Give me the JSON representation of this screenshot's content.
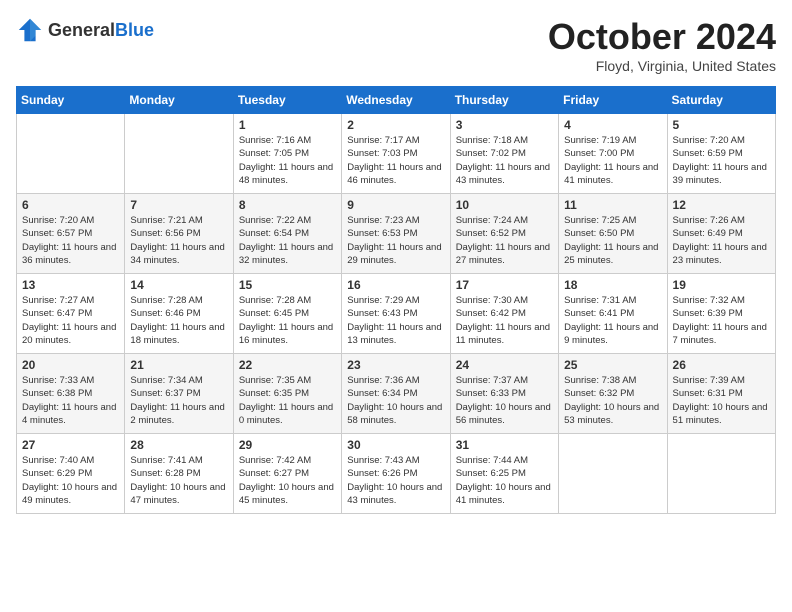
{
  "logo": {
    "general": "General",
    "blue": "Blue"
  },
  "header": {
    "month": "October 2024",
    "location": "Floyd, Virginia, United States"
  },
  "days_of_week": [
    "Sunday",
    "Monday",
    "Tuesday",
    "Wednesday",
    "Thursday",
    "Friday",
    "Saturday"
  ],
  "weeks": [
    [
      {
        "day": "",
        "sunrise": "",
        "sunset": "",
        "daylight": ""
      },
      {
        "day": "",
        "sunrise": "",
        "sunset": "",
        "daylight": ""
      },
      {
        "day": "1",
        "sunrise": "Sunrise: 7:16 AM",
        "sunset": "Sunset: 7:05 PM",
        "daylight": "Daylight: 11 hours and 48 minutes."
      },
      {
        "day": "2",
        "sunrise": "Sunrise: 7:17 AM",
        "sunset": "Sunset: 7:03 PM",
        "daylight": "Daylight: 11 hours and 46 minutes."
      },
      {
        "day": "3",
        "sunrise": "Sunrise: 7:18 AM",
        "sunset": "Sunset: 7:02 PM",
        "daylight": "Daylight: 11 hours and 43 minutes."
      },
      {
        "day": "4",
        "sunrise": "Sunrise: 7:19 AM",
        "sunset": "Sunset: 7:00 PM",
        "daylight": "Daylight: 11 hours and 41 minutes."
      },
      {
        "day": "5",
        "sunrise": "Sunrise: 7:20 AM",
        "sunset": "Sunset: 6:59 PM",
        "daylight": "Daylight: 11 hours and 39 minutes."
      }
    ],
    [
      {
        "day": "6",
        "sunrise": "Sunrise: 7:20 AM",
        "sunset": "Sunset: 6:57 PM",
        "daylight": "Daylight: 11 hours and 36 minutes."
      },
      {
        "day": "7",
        "sunrise": "Sunrise: 7:21 AM",
        "sunset": "Sunset: 6:56 PM",
        "daylight": "Daylight: 11 hours and 34 minutes."
      },
      {
        "day": "8",
        "sunrise": "Sunrise: 7:22 AM",
        "sunset": "Sunset: 6:54 PM",
        "daylight": "Daylight: 11 hours and 32 minutes."
      },
      {
        "day": "9",
        "sunrise": "Sunrise: 7:23 AM",
        "sunset": "Sunset: 6:53 PM",
        "daylight": "Daylight: 11 hours and 29 minutes."
      },
      {
        "day": "10",
        "sunrise": "Sunrise: 7:24 AM",
        "sunset": "Sunset: 6:52 PM",
        "daylight": "Daylight: 11 hours and 27 minutes."
      },
      {
        "day": "11",
        "sunrise": "Sunrise: 7:25 AM",
        "sunset": "Sunset: 6:50 PM",
        "daylight": "Daylight: 11 hours and 25 minutes."
      },
      {
        "day": "12",
        "sunrise": "Sunrise: 7:26 AM",
        "sunset": "Sunset: 6:49 PM",
        "daylight": "Daylight: 11 hours and 23 minutes."
      }
    ],
    [
      {
        "day": "13",
        "sunrise": "Sunrise: 7:27 AM",
        "sunset": "Sunset: 6:47 PM",
        "daylight": "Daylight: 11 hours and 20 minutes."
      },
      {
        "day": "14",
        "sunrise": "Sunrise: 7:28 AM",
        "sunset": "Sunset: 6:46 PM",
        "daylight": "Daylight: 11 hours and 18 minutes."
      },
      {
        "day": "15",
        "sunrise": "Sunrise: 7:28 AM",
        "sunset": "Sunset: 6:45 PM",
        "daylight": "Daylight: 11 hours and 16 minutes."
      },
      {
        "day": "16",
        "sunrise": "Sunrise: 7:29 AM",
        "sunset": "Sunset: 6:43 PM",
        "daylight": "Daylight: 11 hours and 13 minutes."
      },
      {
        "day": "17",
        "sunrise": "Sunrise: 7:30 AM",
        "sunset": "Sunset: 6:42 PM",
        "daylight": "Daylight: 11 hours and 11 minutes."
      },
      {
        "day": "18",
        "sunrise": "Sunrise: 7:31 AM",
        "sunset": "Sunset: 6:41 PM",
        "daylight": "Daylight: 11 hours and 9 minutes."
      },
      {
        "day": "19",
        "sunrise": "Sunrise: 7:32 AM",
        "sunset": "Sunset: 6:39 PM",
        "daylight": "Daylight: 11 hours and 7 minutes."
      }
    ],
    [
      {
        "day": "20",
        "sunrise": "Sunrise: 7:33 AM",
        "sunset": "Sunset: 6:38 PM",
        "daylight": "Daylight: 11 hours and 4 minutes."
      },
      {
        "day": "21",
        "sunrise": "Sunrise: 7:34 AM",
        "sunset": "Sunset: 6:37 PM",
        "daylight": "Daylight: 11 hours and 2 minutes."
      },
      {
        "day": "22",
        "sunrise": "Sunrise: 7:35 AM",
        "sunset": "Sunset: 6:35 PM",
        "daylight": "Daylight: 11 hours and 0 minutes."
      },
      {
        "day": "23",
        "sunrise": "Sunrise: 7:36 AM",
        "sunset": "Sunset: 6:34 PM",
        "daylight": "Daylight: 10 hours and 58 minutes."
      },
      {
        "day": "24",
        "sunrise": "Sunrise: 7:37 AM",
        "sunset": "Sunset: 6:33 PM",
        "daylight": "Daylight: 10 hours and 56 minutes."
      },
      {
        "day": "25",
        "sunrise": "Sunrise: 7:38 AM",
        "sunset": "Sunset: 6:32 PM",
        "daylight": "Daylight: 10 hours and 53 minutes."
      },
      {
        "day": "26",
        "sunrise": "Sunrise: 7:39 AM",
        "sunset": "Sunset: 6:31 PM",
        "daylight": "Daylight: 10 hours and 51 minutes."
      }
    ],
    [
      {
        "day": "27",
        "sunrise": "Sunrise: 7:40 AM",
        "sunset": "Sunset: 6:29 PM",
        "daylight": "Daylight: 10 hours and 49 minutes."
      },
      {
        "day": "28",
        "sunrise": "Sunrise: 7:41 AM",
        "sunset": "Sunset: 6:28 PM",
        "daylight": "Daylight: 10 hours and 47 minutes."
      },
      {
        "day": "29",
        "sunrise": "Sunrise: 7:42 AM",
        "sunset": "Sunset: 6:27 PM",
        "daylight": "Daylight: 10 hours and 45 minutes."
      },
      {
        "day": "30",
        "sunrise": "Sunrise: 7:43 AM",
        "sunset": "Sunset: 6:26 PM",
        "daylight": "Daylight: 10 hours and 43 minutes."
      },
      {
        "day": "31",
        "sunrise": "Sunrise: 7:44 AM",
        "sunset": "Sunset: 6:25 PM",
        "daylight": "Daylight: 10 hours and 41 minutes."
      },
      {
        "day": "",
        "sunrise": "",
        "sunset": "",
        "daylight": ""
      },
      {
        "day": "",
        "sunrise": "",
        "sunset": "",
        "daylight": ""
      }
    ]
  ]
}
